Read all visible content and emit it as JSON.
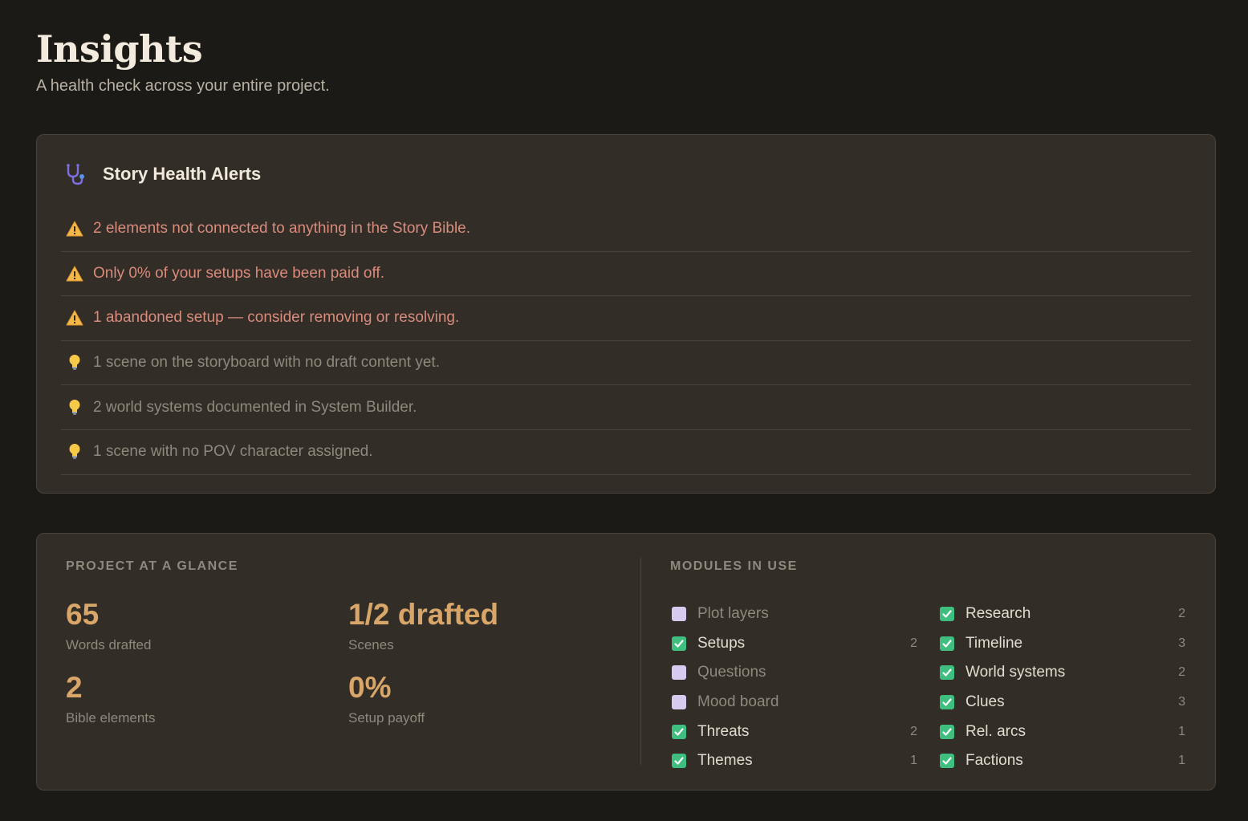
{
  "header": {
    "title": "Insights",
    "subtitle": "A health check across your entire project."
  },
  "alerts": {
    "title": "Story Health Alerts",
    "icon": "stethoscope-icon",
    "items": [
      {
        "type": "warning",
        "icon": "warning-icon",
        "text": "2 elements not connected to anything in the Story Bible."
      },
      {
        "type": "warning",
        "icon": "warning-icon",
        "text": "Only 0% of your setups have been paid off."
      },
      {
        "type": "warning",
        "icon": "warning-icon",
        "text": "1 abandoned setup — consider removing or resolving."
      },
      {
        "type": "tip",
        "icon": "lightbulb-icon",
        "text": "1 scene on the storyboard with no draft content yet."
      },
      {
        "type": "tip",
        "icon": "lightbulb-icon",
        "text": "2 world systems documented in System Builder."
      },
      {
        "type": "tip",
        "icon": "lightbulb-icon",
        "text": "1 scene with no POV character assigned."
      }
    ]
  },
  "glance": {
    "label": "PROJECT AT A GLANCE",
    "stats": [
      {
        "value": "65",
        "label": "Words drafted"
      },
      {
        "value": "1/2 drafted",
        "label": "Scenes"
      },
      {
        "value": "2",
        "label": "Bible elements"
      },
      {
        "value": "0%",
        "label": "Setup payoff"
      }
    ]
  },
  "modules": {
    "label": "MODULES IN USE",
    "left": [
      {
        "name": "Plot layers",
        "enabled": false,
        "count": ""
      },
      {
        "name": "Setups",
        "enabled": true,
        "count": "2"
      },
      {
        "name": "Questions",
        "enabled": false,
        "count": ""
      },
      {
        "name": "Mood board",
        "enabled": false,
        "count": ""
      },
      {
        "name": "Threats",
        "enabled": true,
        "count": "2"
      },
      {
        "name": "Themes",
        "enabled": true,
        "count": "1"
      }
    ],
    "right": [
      {
        "name": "Research",
        "enabled": true,
        "count": "2"
      },
      {
        "name": "Timeline",
        "enabled": true,
        "count": "3"
      },
      {
        "name": "World systems",
        "enabled": true,
        "count": "2"
      },
      {
        "name": "Clues",
        "enabled": true,
        "count": "3"
      },
      {
        "name": "Rel. arcs",
        "enabled": true,
        "count": "1"
      },
      {
        "name": "Factions",
        "enabled": true,
        "count": "1"
      }
    ]
  },
  "colors": {
    "background": "#1c1a17",
    "card": "#322d27",
    "accent": "#d9a66a",
    "warning_text": "#d98b7c",
    "enabled_check": "#3fbf7f",
    "disabled_check": "#d8c9ef"
  }
}
